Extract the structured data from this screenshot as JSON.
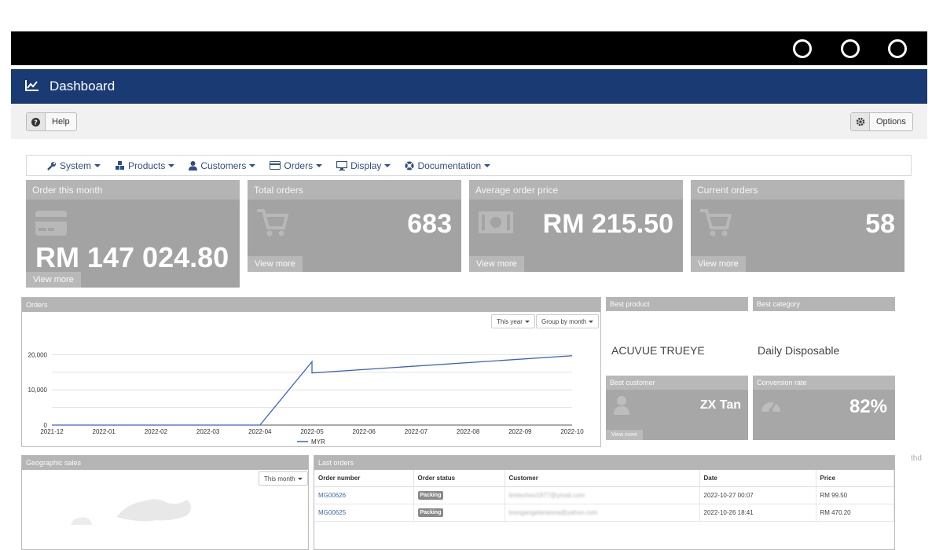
{
  "window": {
    "controls": [
      "circle",
      "circle",
      "circle"
    ]
  },
  "header": {
    "title": "Dashboard",
    "icon": "line-chart-icon"
  },
  "toolbar": {
    "help_label": "Help",
    "options_label": "Options"
  },
  "nav": [
    {
      "label": "System",
      "icon": "wrench-icon"
    },
    {
      "label": "Products",
      "icon": "cubes-icon"
    },
    {
      "label": "Customers",
      "icon": "user-icon"
    },
    {
      "label": "Orders",
      "icon": "credit-card-icon"
    },
    {
      "label": "Display",
      "icon": "desktop-icon"
    },
    {
      "label": "Documentation",
      "icon": "life-ring-icon"
    }
  ],
  "stats": {
    "order_month": {
      "title": "Order this month",
      "value": "RM 147 024.80",
      "more": "View more"
    },
    "total_orders": {
      "title": "Total orders",
      "value": "683",
      "more": "View more"
    },
    "avg_price": {
      "title": "Average order price",
      "value": "RM 215.50",
      "more": "View more"
    },
    "current_orders": {
      "title": "Current orders",
      "value": "58",
      "more": "View more"
    }
  },
  "orders_panel": {
    "title": "Orders",
    "range_btn": "This year",
    "group_btn": "Group by month",
    "legend": "MYR"
  },
  "chart_data": {
    "type": "line",
    "x": [
      "2021-12",
      "2022-01",
      "2022-02",
      "2022-03",
      "2022-04",
      "2022-05",
      "2022-06",
      "2022-07",
      "2022-08",
      "2022-09",
      "2022-10"
    ],
    "series": [
      {
        "name": "MYR",
        "points": [
          [
            "2021-12",
            0
          ],
          [
            "2022-01",
            0
          ],
          [
            "2022-02",
            0
          ],
          [
            "2022-03",
            0
          ],
          [
            "2022-04",
            0
          ],
          [
            "2022-05",
            18000
          ],
          [
            "2022-05.3",
            14800
          ],
          [
            "2022-10",
            19700
          ]
        ]
      }
    ],
    "yticks": [
      "0",
      "10,000",
      "20,000"
    ],
    "ylim": [
      0,
      25000
    ],
    "grid": true,
    "legend_position": "bottom"
  },
  "best_product": {
    "title": "Best product",
    "value": "ACUVUE TRUEYE"
  },
  "best_category": {
    "title": "Best category",
    "value": "Daily Disposable"
  },
  "best_customer": {
    "title": "Best customer",
    "value": "ZX Tan",
    "more": "View more"
  },
  "conversion": {
    "title": "Conversion rate",
    "value": "82%"
  },
  "side_fragment": "thd",
  "geo_panel": {
    "title": "Geographic sales",
    "range_btn": "This month"
  },
  "last_orders": {
    "title": "Last orders",
    "columns": [
      "Order number",
      "Order status",
      "Customer",
      "Date",
      "Price"
    ],
    "rows": [
      {
        "number": "MG00626",
        "status": "Packing",
        "customer": "limteoheo1977@ymail.com",
        "date": "2022-10-27 00:07",
        "price": "RM 99.50"
      },
      {
        "number": "MG00625",
        "status": "Packing",
        "customer": "loongangelarianna@yahoo.com",
        "date": "2022-10-26 18:41",
        "price": "RM 470.20"
      }
    ]
  },
  "colors": {
    "header": "#1a3a73",
    "tile": "#a3a3a3",
    "line": "#3b62c4",
    "link": "#3a6bb3"
  }
}
